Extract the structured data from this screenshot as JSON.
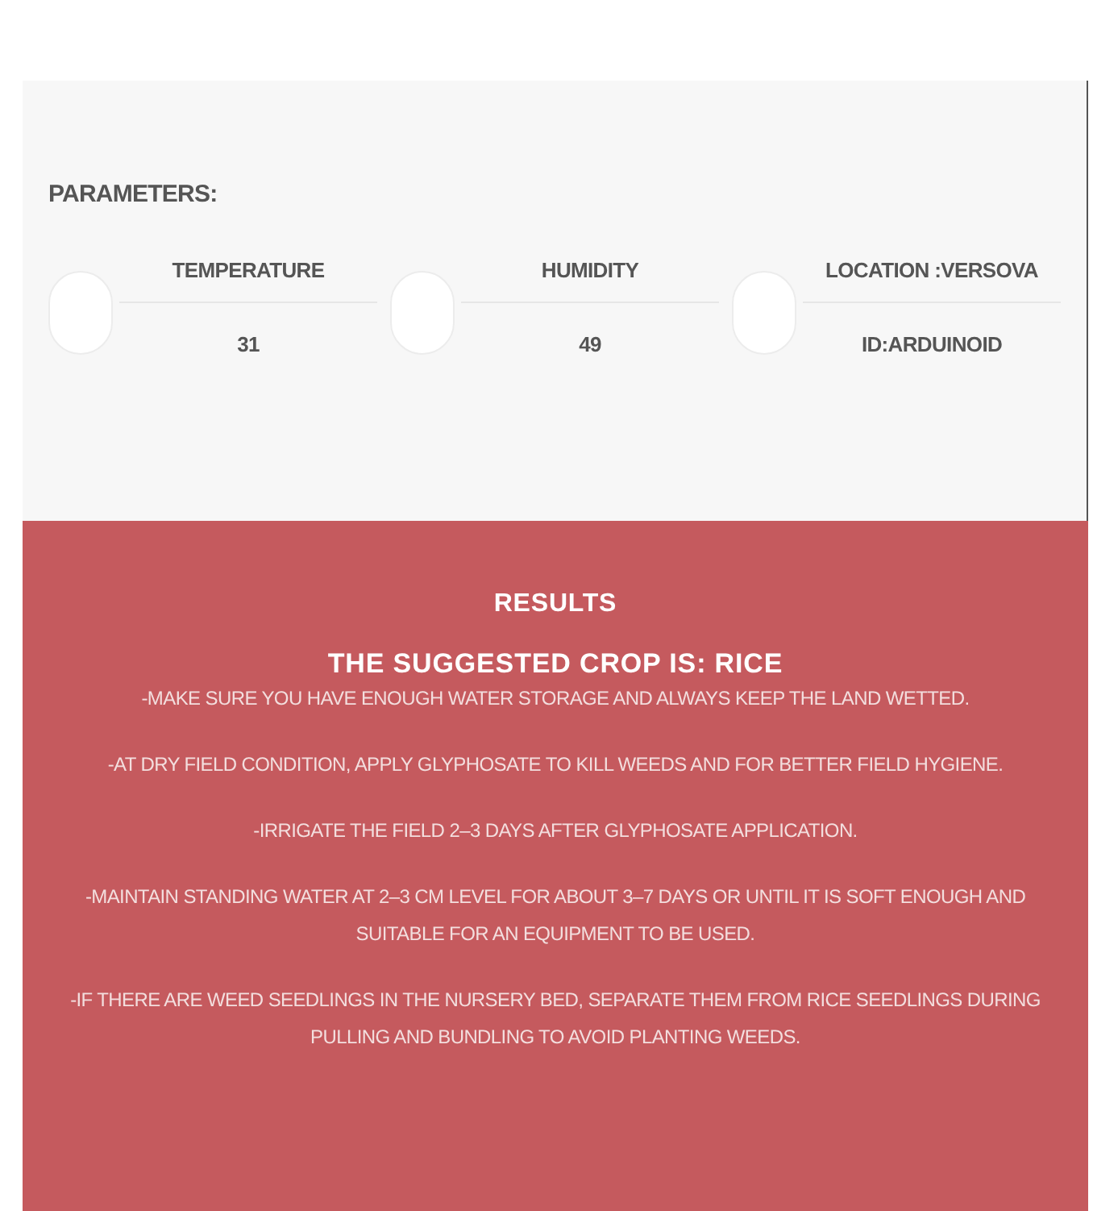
{
  "parameters": {
    "title": "PARAMETERS:",
    "items": [
      {
        "label": "TEMPERATURE",
        "value": "31"
      },
      {
        "label": "HUMIDITY",
        "value": "49"
      },
      {
        "label": "LOCATION :VERSOVA",
        "value": "ID:ARDUINOID"
      }
    ]
  },
  "results": {
    "title": "RESULTS",
    "crop": "THE SUGGESTED CROP IS: RICE",
    "tips": [
      "-MAKE SURE YOU HAVE ENOUGH WATER STORAGE AND ALWAYS KEEP THE LAND WETTED.",
      "-AT DRY FIELD CONDITION, APPLY GLYPHOSATE TO KILL WEEDS AND FOR BETTER FIELD HYGIENE.",
      "-IRRIGATE THE FIELD 2–3 DAYS AFTER GLYPHOSATE APPLICATION.",
      "-MAINTAIN STANDING WATER AT 2–3 CM LEVEL FOR ABOUT 3–7 DAYS OR UNTIL IT IS SOFT ENOUGH AND SUITABLE FOR AN EQUIPMENT TO BE USED.",
      "-IF THERE ARE WEED SEEDLINGS IN THE NURSERY BED, SEPARATE THEM FROM RICE SEEDLINGS DURING PULLING AND BUNDLING TO AVOID PLANTING WEEDS."
    ]
  }
}
